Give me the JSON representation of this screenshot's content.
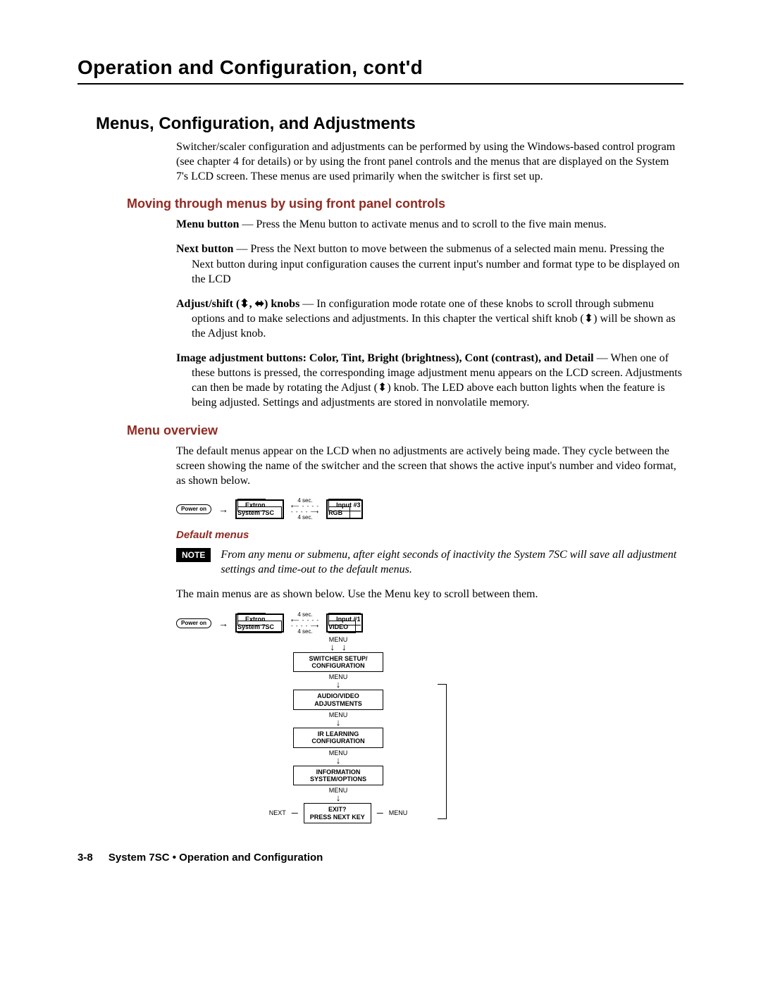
{
  "header": {
    "title": "Operation and Configuration, cont'd"
  },
  "section": {
    "title": "Menus, Configuration, and Adjustments",
    "intro": "Switcher/scaler configuration and adjustments can be performed by using the Windows-based control program (see chapter 4 for details) or by using the front panel controls and the menus that are displayed on the System 7's LCD screen. These menus are used primarily when the switcher is first set up."
  },
  "moving": {
    "heading": "Moving through menus by using front panel controls",
    "items": {
      "menu_button": {
        "lead": "Menu button",
        "body": " — Press the Menu button to activate menus and to scroll to the five main menus."
      },
      "next_button": {
        "lead": "Next button",
        "body": " —  Press the Next button to move between the submenus of a selected main menu.  Pressing the Next button during input configuration causes the current input's number and format type to be displayed on the LCD"
      },
      "adjust": {
        "lead": "Adjust/shift (⬍, ⬌) knobs",
        "body": " —  In configuration mode rotate one of these knobs to scroll through submenu options and to make selections and adjustments.  In this chapter the vertical shift knob (⬍) will be shown as the Adjust knob."
      },
      "image": {
        "lead": "Image adjustment buttons: Color, Tint, Bright (brightness), Cont (contrast), and Detail",
        "body": " —  When one of these buttons is pressed, the corresponding image adjustment menu appears on the LCD screen.  Adjustments can then be made by rotating the Adjust (⬍) knob.  The LED above each button lights when the feature is being adjusted.  Settings and adjustments are stored in nonvolatile memory."
      }
    }
  },
  "overview": {
    "heading": "Menu overview",
    "para1": "The default menus appear on the LCD when no adjustments are actively being made.  They cycle between the screen showing the name of the switcher and the screen that shows the active input's number and video format, as shown below.",
    "default_heading": "Default menus",
    "note_label": "NOTE",
    "note_text": "From any menu or submenu, after eight seconds of inactivity the System 7SC will save all adjustment settings and time-out to the default menus.",
    "para2": "The main menus are as shown below.  Use the Menu key to scroll between them."
  },
  "diagram1": {
    "power": "Power\non",
    "lcd1_l1": "Extron",
    "lcd1_l2": "System 7SC",
    "sec_top": "4 sec.",
    "sec_bot": "4 sec.",
    "lcd2_l1": "Input #3",
    "lcd2_l2": "RGB"
  },
  "diagram2": {
    "power": "Power\non",
    "lcd1_l1": "Extron",
    "lcd1_l2": "System 7SC",
    "sec_top": "4 sec.",
    "sec_bot": "4 sec.",
    "lcd2_l1": "Input #1",
    "lcd2_l2": "VIDEO",
    "menu_label": "MENU",
    "boxes": {
      "b1_l1": "SWITCHER SETUP/",
      "b1_l2": "CONFIGURATION",
      "b2_l1": "AUDIO/VIDEO",
      "b2_l2": "ADJUSTMENTS",
      "b3_l1": "IR LEARNING",
      "b3_l2": "CONFIGURATION",
      "b4_l1": "INFORMATION",
      "b4_l2": "SYSTEM/OPTIONS",
      "b5_l1": "EXIT?",
      "b5_l2": "PRESS NEXT KEY"
    },
    "next_label": "NEXT",
    "menu_side": "MENU"
  },
  "footer": {
    "page": "3-8",
    "text": "System 7SC • Operation and Configuration"
  }
}
